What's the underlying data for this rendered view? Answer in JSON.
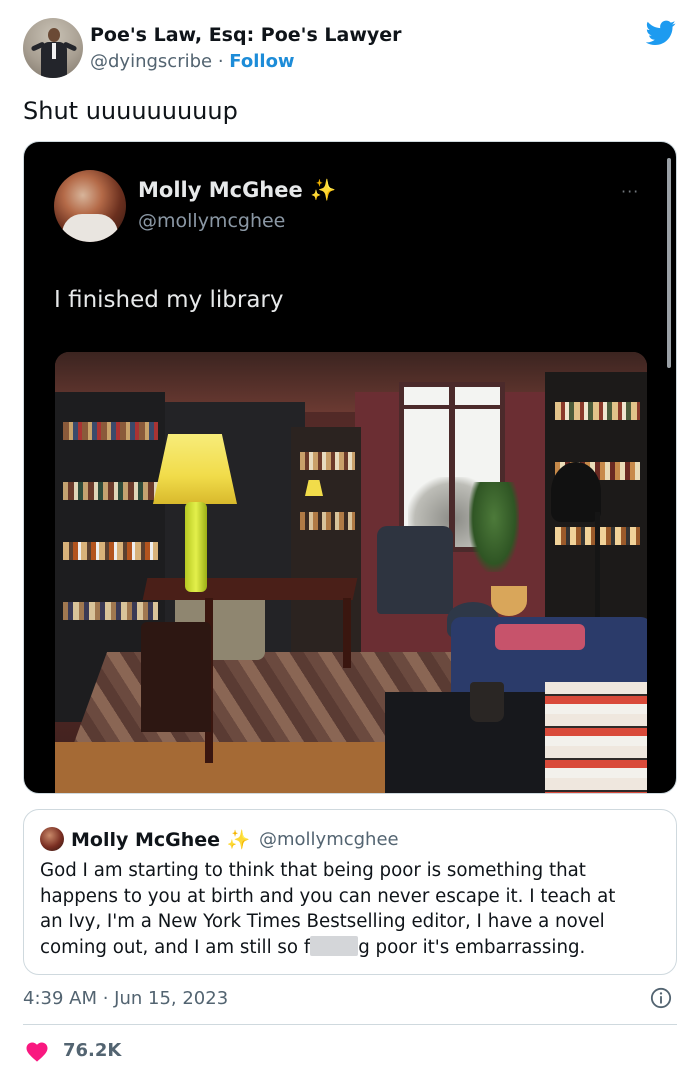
{
  "author": {
    "display_name": "Poe's Law, Esq: Poe's Lawyer",
    "handle": "@dyingscribe",
    "separator": "·",
    "follow_label": "Follow"
  },
  "tweet": {
    "text": "Shut uuuuuuuuup"
  },
  "embedded_post": {
    "display_name": "Molly McGhee",
    "sparkle": "✨",
    "handle": "@mollymcghee",
    "more": "···",
    "text": "I finished my library"
  },
  "quoted_tweet": {
    "display_name": "Molly McGhee",
    "sparkle": "✨",
    "handle": "@mollymcghee",
    "lines": [
      "God I am starting to think that being poor is something that",
      "happens to you at birth and you can never escape it. I teach at",
      "an Ivy, I'm a New York Times Bestselling editor, I have a novel"
    ],
    "last_line_before": "coming out, and I am still so f",
    "last_line_after": "g poor it's embarrassing."
  },
  "footer": {
    "timestamp": "4:39 AM · Jun 15, 2023",
    "likes": "76.2K"
  },
  "colors": {
    "twitter_blue": "#1d9bf0",
    "like_red": "#f91880",
    "text_secondary": "#536471"
  },
  "icons": {
    "brand": "twitter-bird-icon",
    "info": "info-icon",
    "like": "heart-icon"
  }
}
